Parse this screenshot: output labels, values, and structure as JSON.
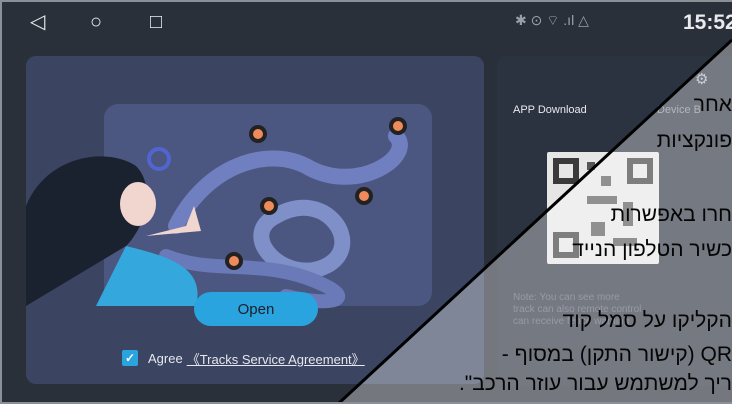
{
  "statusbar": {
    "back_icon": "◁",
    "home_icon": "○",
    "recents_icon": "□",
    "status_icons": "✱ ⊙ ⌔ .ıl △",
    "time": "15:52"
  },
  "left": {
    "open_label": "Open",
    "agree_text": "Agree",
    "agreement_link": "《Tracks Service Agreement》"
  },
  "right": {
    "tab_app": "APP Download",
    "tab_device": "Device B",
    "note": "Note: You can see more track can also remote control can receive fence warning"
  },
  "overlay": {
    "line1": "אחר",
    "line2": "פונקציות",
    "line3": "חרו באפשרות",
    "line4": "כשיר הטלפון הנייד",
    "line5": "הקליקו על סמל קוד",
    "line6": "QR (קישור התקן) במסוף -",
    "line7": "ריך למשתמש עבור עוזר הרכב\"."
  },
  "colors": {
    "accent": "#2aa4df",
    "card": "#3b4562",
    "panel": "#2b3240"
  }
}
